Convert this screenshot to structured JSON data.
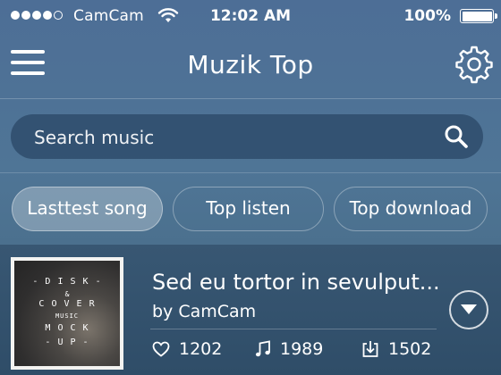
{
  "status_bar": {
    "signal_bars_filled": 4,
    "signal_bars_total": 5,
    "carrier": "CamCam",
    "time": "12:02 AM",
    "battery_percent": "100%",
    "battery_level": 1.0,
    "wifi_icon": "wifi-icon",
    "battery_icon": "battery-icon"
  },
  "nav": {
    "title": "Muzik Top",
    "menu_icon": "hamburger-menu-icon",
    "settings_icon": "gear-icon"
  },
  "search": {
    "placeholder": "Search music",
    "value": "",
    "icon": "search-icon"
  },
  "tabs": [
    {
      "label": "Lasttest song",
      "active": true
    },
    {
      "label": "Top listen",
      "active": false
    },
    {
      "label": "Top download",
      "active": false
    }
  ],
  "songs": [
    {
      "title": "Sed eu tortor in sevulput...",
      "artist": "by CamCam",
      "likes": "1202",
      "plays": "1989",
      "downloads": "1502",
      "album_art": {
        "line1": "- D I S K -",
        "line2": "&",
        "line3": "C O V E R",
        "line4": "MUSIC",
        "line5": "M O C K",
        "line6": "- U P -"
      }
    }
  ],
  "colors": {
    "background_top": "#4d6e96",
    "background_bottom": "#3e5f7c",
    "song_row": "#385773",
    "text": "#ffffff"
  }
}
